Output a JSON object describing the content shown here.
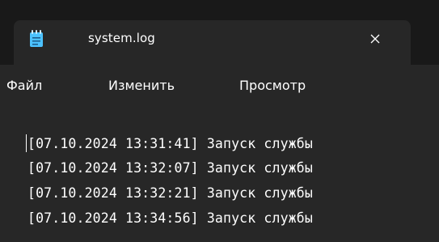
{
  "tab": {
    "title": "system.log",
    "icon": "notepad-icon",
    "close_icon": "close-icon"
  },
  "menu": {
    "file": "Файл",
    "edit": "Изменить",
    "view": "Просмотр"
  },
  "editor": {
    "lines": [
      "[07.10.2024 13:31:41] Запуск службы",
      "[07.10.2024 13:32:07] Запуск службы",
      "[07.10.2024 13:32:21] Запуск службы",
      "[07.10.2024 13:34:56] Запуск службы"
    ]
  },
  "colors": {
    "titlebar": "#191919",
    "tab": "#272727",
    "editor_bg": "#272727",
    "text": "#ffffff",
    "icon_accent": "#4cc2ff"
  }
}
